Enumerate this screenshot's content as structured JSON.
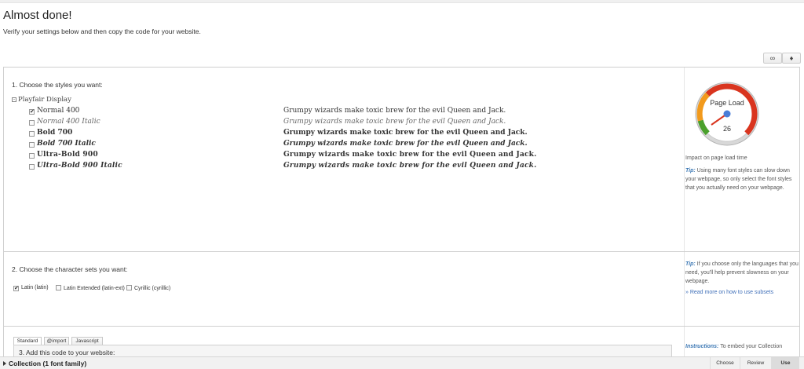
{
  "page": {
    "title": "Almost done!",
    "subtitle": "Verify your settings below and then copy the code for your website."
  },
  "toolbar": {
    "link_icon": "link-icon",
    "bookmark_icon": "bookmark-icon"
  },
  "styles_section": {
    "title": "1. Choose the styles you want:",
    "family": "Playfair Display",
    "styles": [
      {
        "label": "Normal 400",
        "checked": true,
        "sample": "Grumpy wizards make toxic brew for the evil Queen and Jack."
      },
      {
        "label": "Normal 400 Italic",
        "checked": false,
        "sample": "Grumpy wizards make toxic brew for the evil Queen and Jack."
      },
      {
        "label": "Bold 700",
        "checked": false,
        "sample": "Grumpy wizards make toxic brew for the evil Queen and Jack."
      },
      {
        "label": "Bold 700 Italic",
        "checked": false,
        "sample": "Grumpy wizards make toxic brew for the evil Queen and Jack."
      },
      {
        "label": "Ultra-Bold 900",
        "checked": false,
        "sample": "Grumpy wizards make toxic brew for the evil Queen and Jack."
      },
      {
        "label": "Ultra-Bold 900 Italic",
        "checked": false,
        "sample": "Grumpy wizards make toxic brew for the evil Queen and Jack."
      }
    ],
    "gauge": {
      "label": "Page Load",
      "value": "26"
    },
    "impact_text": "Impact on page load time",
    "tip_label": "Tip:",
    "tip_text": "Using many font styles can slow down your webpage, so only select the font styles that you actually need on your webpage."
  },
  "charsets_section": {
    "title": "2. Choose the character sets you want:",
    "options": [
      {
        "label": "Latin (latin)",
        "checked": true
      },
      {
        "label": "Latin Extended (latin-ext)",
        "checked": false
      },
      {
        "label": "Cyrillic (cyrillic)",
        "checked": false
      }
    ],
    "tip_label": "Tip:",
    "tip_text": "If you choose only the languages that you need, you'll help prevent slowness on your webpage.",
    "link": "» Read more on how to use subsets"
  },
  "code_section": {
    "tabs": [
      "Standard",
      "@import",
      "Javascript"
    ],
    "title": "3. Add this code to your website:",
    "instructions_label": "Instructions:",
    "instructions_text": "To embed your Collection"
  },
  "bottombar": {
    "title": "Collection (1 font family)",
    "steps": [
      "Choose",
      "Review",
      "Use"
    ],
    "active_step": "Use"
  },
  "colors": {
    "accent": "#3c78b4",
    "gauge_red": "#d9351f",
    "gauge_orange": "#f29a1d",
    "gauge_green": "#4aa02c",
    "needle": "#4a7ed8"
  }
}
